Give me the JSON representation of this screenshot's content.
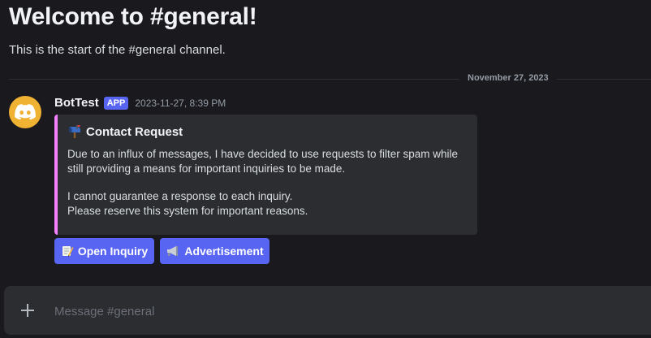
{
  "welcome": {
    "title": "Welcome to #general!",
    "subtitle": "This is the start of the #general channel."
  },
  "divider": {
    "date": "November 27, 2023"
  },
  "message": {
    "author": "BotTest",
    "badge": "APP",
    "timestamp": "2023-11-27, 8:39 PM",
    "avatar_icon": "discord-logo-icon",
    "avatar_color": "#f0b232",
    "embed": {
      "accent_color": "#f47fff",
      "title_icon": "mailbox-icon",
      "title": "Contact Request",
      "line1": "Due to an influx of messages, I have decided to use requests to filter spam while still providing a means for important inquiries to be made.",
      "line2": "I cannot guarantee a response to each inquiry.",
      "line3": "Please reserve this system for important reasons."
    },
    "buttons": [
      {
        "icon": "memo-icon",
        "label": "Open Inquiry"
      },
      {
        "icon": "megaphone-icon",
        "label": "Advertisement"
      }
    ]
  },
  "composer": {
    "placeholder": "Message #general",
    "value": ""
  },
  "colors": {
    "background": "#1a1a1e",
    "blurple": "#5865f2",
    "embed_bg": "#2b2d31"
  }
}
